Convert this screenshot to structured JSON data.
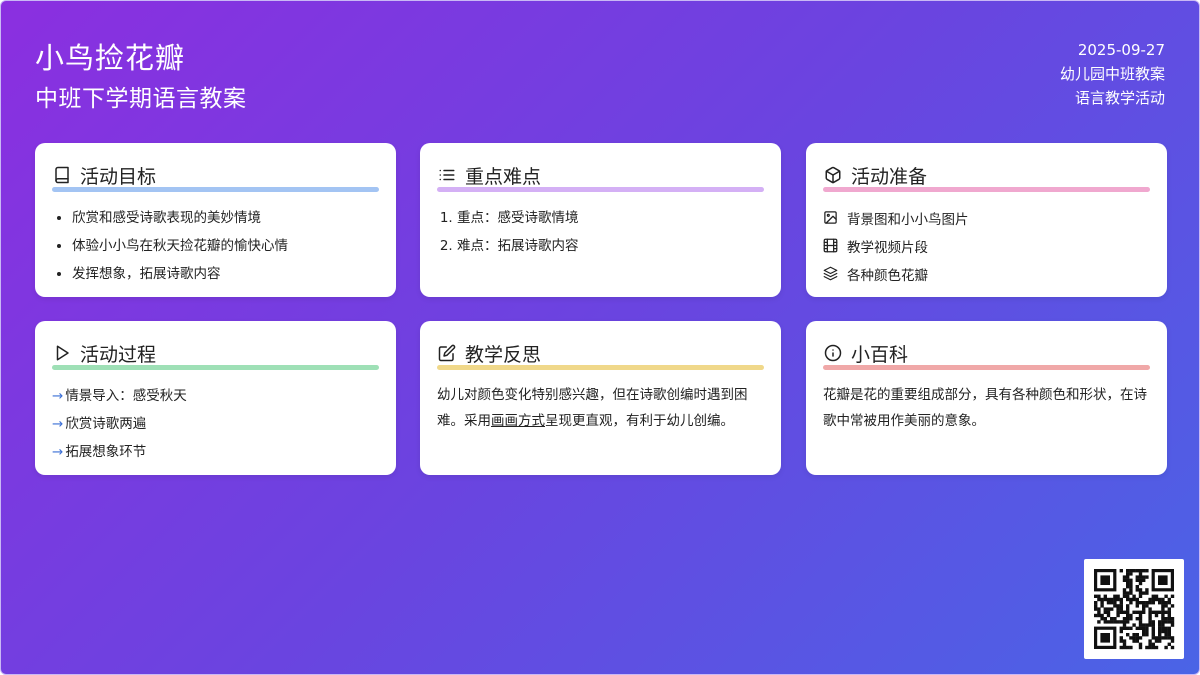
{
  "header": {
    "title": "小鸟捡花瓣",
    "subtitle": "中班下学期语言教案",
    "date": "2025-09-27",
    "meta_line1": "幼儿园中班教案",
    "meta_line2": "语言教学活动"
  },
  "cards": {
    "goals": {
      "title": "活动目标",
      "icon": "book-icon",
      "accent": "#a3c4f3",
      "items": [
        "欣赏和感受诗歌表现的美妙情境",
        "体验小小鸟在秋天捡花瓣的愉快心情",
        "发挥想象，拓展诗歌内容"
      ]
    },
    "key_points": {
      "title": "重点难点",
      "icon": "list-icon",
      "accent": "#d4b0f5",
      "items": [
        "重点：感受诗歌情境",
        "难点：拓展诗歌内容"
      ]
    },
    "preparation": {
      "title": "活动准备",
      "icon": "cube-icon",
      "accent": "#f0a8cf",
      "items": [
        {
          "icon": "image-icon",
          "text": "背景图和小小鸟图片"
        },
        {
          "icon": "film-icon",
          "text": "教学视频片段"
        },
        {
          "icon": "layers-icon",
          "text": "各种颜色花瓣"
        }
      ]
    },
    "process": {
      "title": "活动过程",
      "icon": "play-icon",
      "accent": "#9ee0b6",
      "items": [
        "情景导入：感受秋天",
        "欣赏诗歌两遍",
        "拓展想象环节"
      ]
    },
    "reflection": {
      "title": "教学反思",
      "icon": "edit-icon",
      "accent": "#f0d88a",
      "text_before": "幼儿对颜色变化特别感兴趣，但在诗歌创编时遇到困难。采用",
      "text_underlined": "画画方式",
      "text_after": "呈现更直观，有利于幼儿创编。"
    },
    "encyclopedia": {
      "title": "小百科",
      "icon": "info-icon",
      "accent": "#f0a8a8",
      "text": "花瓣是花的重要组成部分，具有各种颜色和形状，在诗歌中常被用作美丽的意象。"
    }
  },
  "qr_code": {
    "icon": "qr-code-icon"
  }
}
